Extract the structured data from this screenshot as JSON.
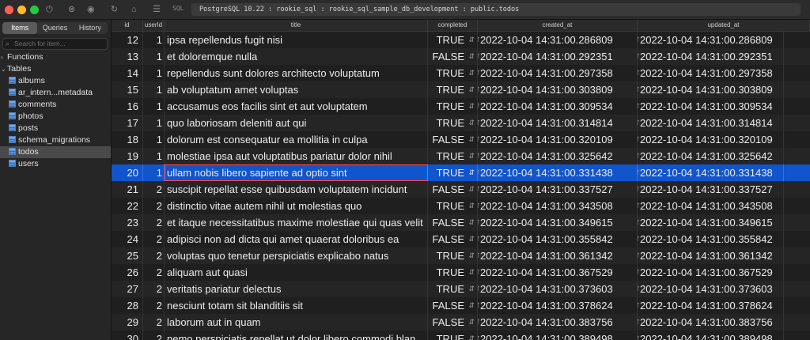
{
  "titlebar": {
    "sql_label": "SQL",
    "connection": "PostgreSQL 10.22 : rookie_sql : rookie_sql_sample_db_development : public.todos",
    "icons": [
      "back-icon",
      "refresh-icon",
      "eye-icon",
      "lock-icon",
      "list-icon"
    ],
    "traffic_colors": [
      "#ff5f57",
      "#febc2e",
      "#28c840"
    ]
  },
  "sidebar": {
    "tabs": [
      "Items",
      "Queries",
      "History"
    ],
    "active_tab": "Items",
    "search_placeholder": "Search for item...",
    "groups": [
      {
        "label": "Functions"
      },
      {
        "label": "Tables"
      }
    ],
    "tables": [
      "albums",
      "ar_intern...metadata",
      "comments",
      "photos",
      "posts",
      "schema_migrations",
      "todos",
      "users"
    ],
    "selected_table": "todos"
  },
  "grid": {
    "columns": [
      "id",
      "userId",
      "title",
      "completed",
      "created_at",
      "updated_at"
    ],
    "selected_row_id": "20",
    "rows": [
      [
        "12",
        "1",
        "ipsa repellendus fugit nisi",
        "TRUE",
        "2022-10-04 14:31:00.286809",
        "2022-10-04 14:31:00.286809"
      ],
      [
        "13",
        "1",
        "et doloremque nulla",
        "FALSE",
        "2022-10-04 14:31:00.292351",
        "2022-10-04 14:31:00.292351"
      ],
      [
        "14",
        "1",
        "repellendus sunt dolores architecto voluptatum",
        "TRUE",
        "2022-10-04 14:31:00.297358",
        "2022-10-04 14:31:00.297358"
      ],
      [
        "15",
        "1",
        "ab voluptatum amet voluptas",
        "TRUE",
        "2022-10-04 14:31:00.303809",
        "2022-10-04 14:31:00.303809"
      ],
      [
        "16",
        "1",
        "accusamus eos facilis sint et aut voluptatem",
        "TRUE",
        "2022-10-04 14:31:00.309534",
        "2022-10-04 14:31:00.309534"
      ],
      [
        "17",
        "1",
        "quo laboriosam deleniti aut qui",
        "TRUE",
        "2022-10-04 14:31:00.314814",
        "2022-10-04 14:31:00.314814"
      ],
      [
        "18",
        "1",
        "dolorum est consequatur ea mollitia in culpa",
        "FALSE",
        "2022-10-04 14:31:00.320109",
        "2022-10-04 14:31:00.320109"
      ],
      [
        "19",
        "1",
        "molestiae ipsa aut voluptatibus pariatur dolor nihil",
        "TRUE",
        "2022-10-04 14:31:00.325642",
        "2022-10-04 14:31:00.325642"
      ],
      [
        "20",
        "1",
        "ullam nobis libero sapiente ad optio sint",
        "TRUE",
        "2022-10-04 14:31:00.331438",
        "2022-10-04 14:31:00.331438"
      ],
      [
        "21",
        "2",
        "suscipit repellat esse quibusdam voluptatem incidunt",
        "FALSE",
        "2022-10-04 14:31:00.337527",
        "2022-10-04 14:31:00.337527"
      ],
      [
        "22",
        "2",
        "distinctio vitae autem nihil ut molestias quo",
        "TRUE",
        "2022-10-04 14:31:00.343508",
        "2022-10-04 14:31:00.343508"
      ],
      [
        "23",
        "2",
        "et itaque necessitatibus maxime molestiae qui quas velit",
        "FALSE",
        "2022-10-04 14:31:00.349615",
        "2022-10-04 14:31:00.349615"
      ],
      [
        "24",
        "2",
        "adipisci non ad dicta qui amet quaerat doloribus ea",
        "FALSE",
        "2022-10-04 14:31:00.355842",
        "2022-10-04 14:31:00.355842"
      ],
      [
        "25",
        "2",
        "voluptas quo tenetur perspiciatis explicabo natus",
        "TRUE",
        "2022-10-04 14:31:00.361342",
        "2022-10-04 14:31:00.361342"
      ],
      [
        "26",
        "2",
        "aliquam aut quasi",
        "TRUE",
        "2022-10-04 14:31:00.367529",
        "2022-10-04 14:31:00.367529"
      ],
      [
        "27",
        "2",
        "veritatis pariatur delectus",
        "TRUE",
        "2022-10-04 14:31:00.373603",
        "2022-10-04 14:31:00.373603"
      ],
      [
        "28",
        "2",
        "nesciunt totam sit blanditiis sit",
        "FALSE",
        "2022-10-04 14:31:00.378624",
        "2022-10-04 14:31:00.378624"
      ],
      [
        "29",
        "2",
        "laborum aut in quam",
        "FALSE",
        "2022-10-04 14:31:00.383756",
        "2022-10-04 14:31:00.383756"
      ],
      [
        "30",
        "2",
        "nemo perspiciatis repellat ut dolor libero commodi blan",
        "TRUE",
        "2022-10-04 14:31:00.389498",
        "2022-10-04 14:31:00.389498"
      ]
    ]
  }
}
